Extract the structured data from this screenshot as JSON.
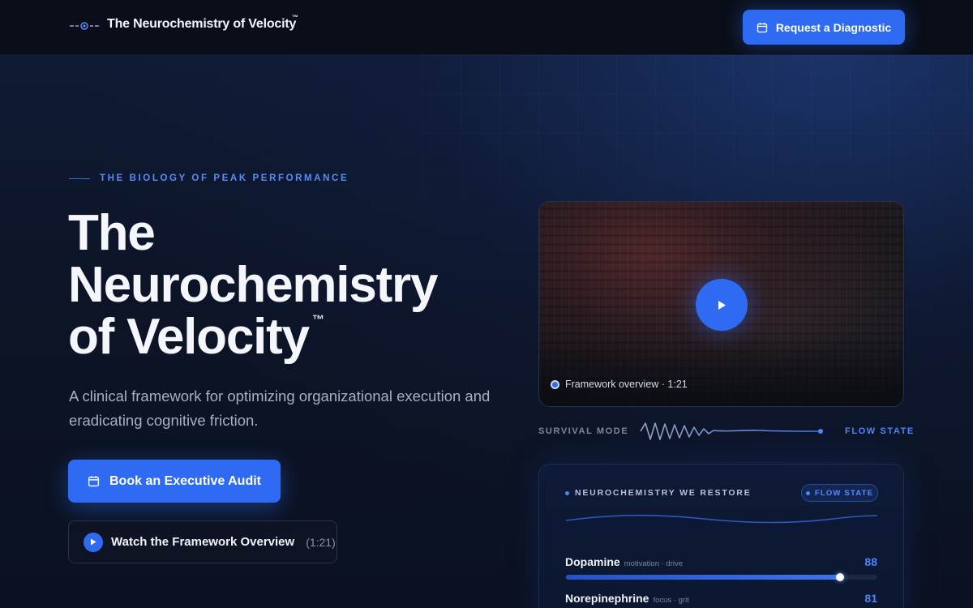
{
  "header": {
    "brand": "The Neurochemistry of Velocity",
    "brand_tm": "™",
    "cta_label": "Request a Diagnostic"
  },
  "hero": {
    "eyebrow": "THE BIOLOGY OF PEAK PERFORMANCE",
    "title": "The Neurochemistry of Velocity",
    "title_tm": "™",
    "subtitle": "A clinical framework for optimizing organizational execution and eradicating cognitive friction.",
    "primary_cta": "Book an Executive Audit",
    "secondary_cta": "Watch the Framework Overview",
    "secondary_cta_duration": "(1:21)"
  },
  "video": {
    "caption": "Framework overview · 1:21"
  },
  "state_scale": {
    "left_label": "SURVIVAL MODE",
    "right_label": "FLOW STATE"
  },
  "neuro_panel": {
    "title": "NEUROCHEMISTRY WE RESTORE",
    "badge": "FLOW STATE",
    "metrics": [
      {
        "name": "Dopamine",
        "tags": "motivation · drive",
        "value": 88
      },
      {
        "name": "Norepinephrine",
        "tags": "focus · grit",
        "value": 81
      }
    ]
  },
  "colors": {
    "accent": "#2f6bf2",
    "accent_text": "#4f86f7",
    "background": "#0b1120"
  },
  "icons": {
    "logo": "waveform-node-icon",
    "calendar": "calendar-icon",
    "play": "play-icon"
  }
}
